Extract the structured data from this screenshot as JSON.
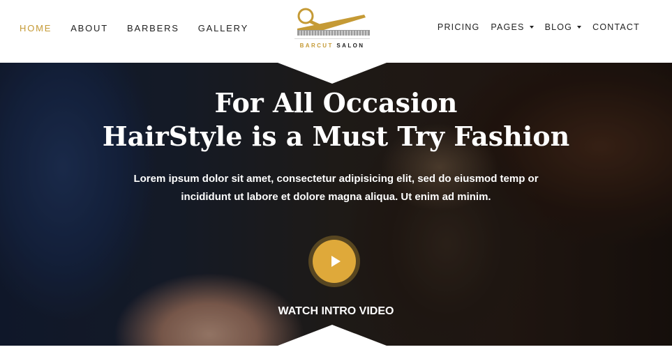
{
  "nav": {
    "left": [
      {
        "label": "HOME",
        "active": true
      },
      {
        "label": "ABOUT"
      },
      {
        "label": "BARBERS"
      },
      {
        "label": "GALLERY"
      }
    ],
    "right": [
      {
        "label": "PRICING"
      },
      {
        "label": "PAGES",
        "dropdown": true
      },
      {
        "label": "BLOG",
        "dropdown": true
      },
      {
        "label": "CONTACT"
      }
    ]
  },
  "logo": {
    "word1": "BARCUT",
    "word2": "SALON",
    "icon": "scissors-comb-icon"
  },
  "hero": {
    "title_line1": "For All Occasion",
    "title_line2": "HairStyle is a Must Try Fashion",
    "text_line1": "Lorem ipsum dolor sit amet, consectetur adipisicing elit, sed do eiusmod temp or",
    "text_line2": "incididunt ut labore et dolore magna aliqua. Ut enim ad minim.",
    "play_icon": "play-icon",
    "watch_label": "WATCH INTRO VIDEO"
  },
  "colors": {
    "accent": "#c59a35",
    "play_button": "#dfa93a",
    "nav_text": "#222222"
  }
}
